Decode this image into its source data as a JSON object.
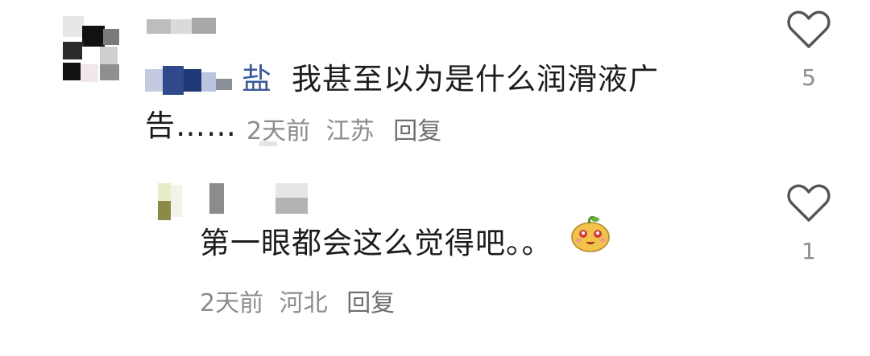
{
  "comments": [
    {
      "username_prefix": "盐",
      "text_line1": "我甚至以为是什么润滑液广",
      "text_line2": "告……",
      "time": "2天前",
      "location": "江苏",
      "reply_label": "回复",
      "like_count": "5",
      "icons": {
        "like": "heart-outline-icon"
      }
    },
    {
      "text": "第一眼都会这么觉得吧。。",
      "emoji": "blushing-mascot-emoji",
      "time": "2天前",
      "location": "河北",
      "reply_label": "回复",
      "like_count": "1",
      "icons": {
        "like": "heart-outline-icon"
      }
    }
  ],
  "colors": {
    "text": "#1c1c1c",
    "meta": "#8c8c8c",
    "icon": "#555555",
    "background": "#ffffff"
  }
}
